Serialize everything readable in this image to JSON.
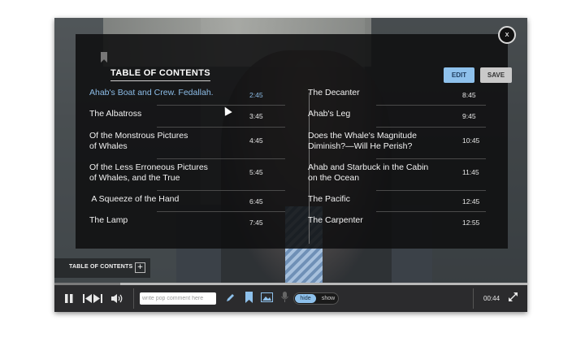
{
  "toc": {
    "title": "TABLE OF CONTENTS",
    "edit_label": "EDIT",
    "save_label": "SAVE",
    "close_label": "x",
    "left": [
      {
        "title_lines": [
          "Ahab's Boat and Crew. Fedallah."
        ],
        "time": "2:45",
        "active": true
      },
      {
        "title_lines": [
          "The Albatross"
        ],
        "time": "3:45"
      },
      {
        "title_lines": [
          "Of the Monstrous Pictures",
          "of Whales"
        ],
        "time": "4:45"
      },
      {
        "title_lines": [
          "Of the Less Erroneous Pictures",
          "of Whales, and the True"
        ],
        "time": "5:45"
      },
      {
        "title_lines": [
          " A Squeeze of the Hand"
        ],
        "time": "6:45"
      },
      {
        "title_lines": [
          "The Lamp"
        ],
        "time": "7:45"
      }
    ],
    "right": [
      {
        "title_lines": [
          "The Decanter"
        ],
        "time": "8:45"
      },
      {
        "title_lines": [
          "Ahab's Leg"
        ],
        "time": "9:45"
      },
      {
        "title_lines": [
          "Does the Whale's Magnitude",
          "Diminish?—Will He Perish?"
        ],
        "time": "10:45"
      },
      {
        "title_lines": [
          "Ahab and Starbuck in the Cabin",
          "on the Ocean"
        ],
        "time": "11:45"
      },
      {
        "title_lines": [
          "The Pacific"
        ],
        "time": "12:45"
      },
      {
        "title_lines": [
          "The Carpenter"
        ],
        "time": "12:55"
      }
    ]
  },
  "toc_toggle": {
    "label": "TABLE OF CONTENTS",
    "plus": "+"
  },
  "player": {
    "progress_fraction": 0.14,
    "comment_placeholder": "write pop comment here",
    "toggle_hide": "hide",
    "toggle_show": "show",
    "timecode": "00:44"
  },
  "icons": {
    "pause": "pause-icon",
    "skip": "skip-previous-next-icon",
    "volume": "volume-icon",
    "pencil": "pencil-icon",
    "bookmark": "bookmark-icon",
    "image": "image-icon",
    "mic": "microphone-icon",
    "fullscreen": "fullscreen-icon"
  },
  "colors": {
    "accent": "#8ec1ec",
    "overlay": "#0f0f10",
    "active_link": "#8cbce6"
  }
}
